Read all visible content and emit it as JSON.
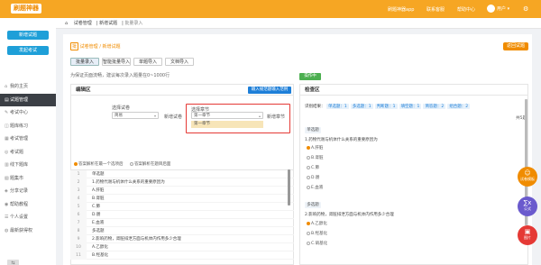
{
  "topbar": {
    "logo": "刷题神器",
    "links": [
      "刷题神器app",
      "联系客服",
      "帮助中心"
    ],
    "user": "用户"
  },
  "sidebar": {
    "new_exam": "新增试题",
    "new_paper": "发起考试",
    "menu": [
      {
        "label": "我的主页",
        "icon": "⌂"
      },
      {
        "label": "试题管理",
        "icon": "▤",
        "active": true
      },
      {
        "label": "考试中心",
        "icon": "✎"
      },
      {
        "label": "题库练习",
        "icon": "◫"
      },
      {
        "label": "考试管理",
        "icon": "▦"
      },
      {
        "label": "考试题",
        "icon": "◎"
      },
      {
        "label": "线下题库",
        "icon": "▥"
      },
      {
        "label": "题集市",
        "icon": "▧"
      },
      {
        "label": "分享记录",
        "icon": "◈"
      },
      {
        "label": "帮助教程",
        "icon": "◉"
      },
      {
        "label": "个人设置",
        "icon": "☰"
      },
      {
        "label": "最新获得权",
        "icon": "◍"
      }
    ],
    "collapse": "⇆"
  },
  "breadcrumb": [
    "⌂",
    "试卷管理",
    "新增试题",
    "批量录入"
  ],
  "main": {
    "tag_label": "批",
    "tag_text": "试卷管理 / 新增试题",
    "back": "返回试题",
    "tabs": [
      "批量录入",
      "智能批量导入",
      "单题导入",
      "文档导入"
    ],
    "hint": "为保证页面流畅，建议每次录入题量在0~1000行",
    "left": {
      "title": "编辑区",
      "import_btn": "输入规范题输入范例",
      "select_type_label": "选择试卷",
      "select_type_value": "简易",
      "subject_label": "新增试卷",
      "chapter_label": "选择章节",
      "chapter_value": "第一章节",
      "new_chapter": "新增章节",
      "drop_item": "第一章节",
      "radio1": "答案解析在最一个选项后",
      "radio2": "答案解析在题目后面",
      "lines": [
        "单选题",
        "1.药物代谢与机体什么关系的重要原因为",
        "A.肝脏",
        "B.肾脏",
        "C.肺",
        "D.肠",
        "E.血液",
        "多选题",
        "2.影响药物，肾脏排泄方面与机体内作用多少合理",
        "A.乙醇化",
        "B.羟基化"
      ]
    },
    "right": {
      "badge": "操作中",
      "title": "检查区",
      "stats_label": "识别结果：",
      "stats": [
        "单选题：1",
        "多选题：1",
        "判断题：1",
        "填空题：1",
        "简答题：2",
        "组合题：2"
      ],
      "total": "共5题",
      "q1_type": "单选题",
      "q1_text": "1.药物代谢与机体什么关系的重要原因为",
      "q1_opts": [
        "A.肝脏",
        "B.肾脏",
        "C.肺",
        "D.肠",
        "E.血液"
      ],
      "q2_type": "多选题",
      "q2_text": "2.影响药物，肾脏排泄方面与机体内作用多少合理",
      "q2_opts": [
        "A.乙醇化",
        "B.羟基化",
        "C.硝基化"
      ]
    }
  },
  "tools": [
    {
      "label": "试卷模板",
      "icon": "☺",
      "color": "#f08c00"
    },
    {
      "label": "公式",
      "icon": "∑x",
      "color": "#6a5acd"
    },
    {
      "label": "图片",
      "icon": "▣",
      "color": "#e53935"
    }
  ]
}
